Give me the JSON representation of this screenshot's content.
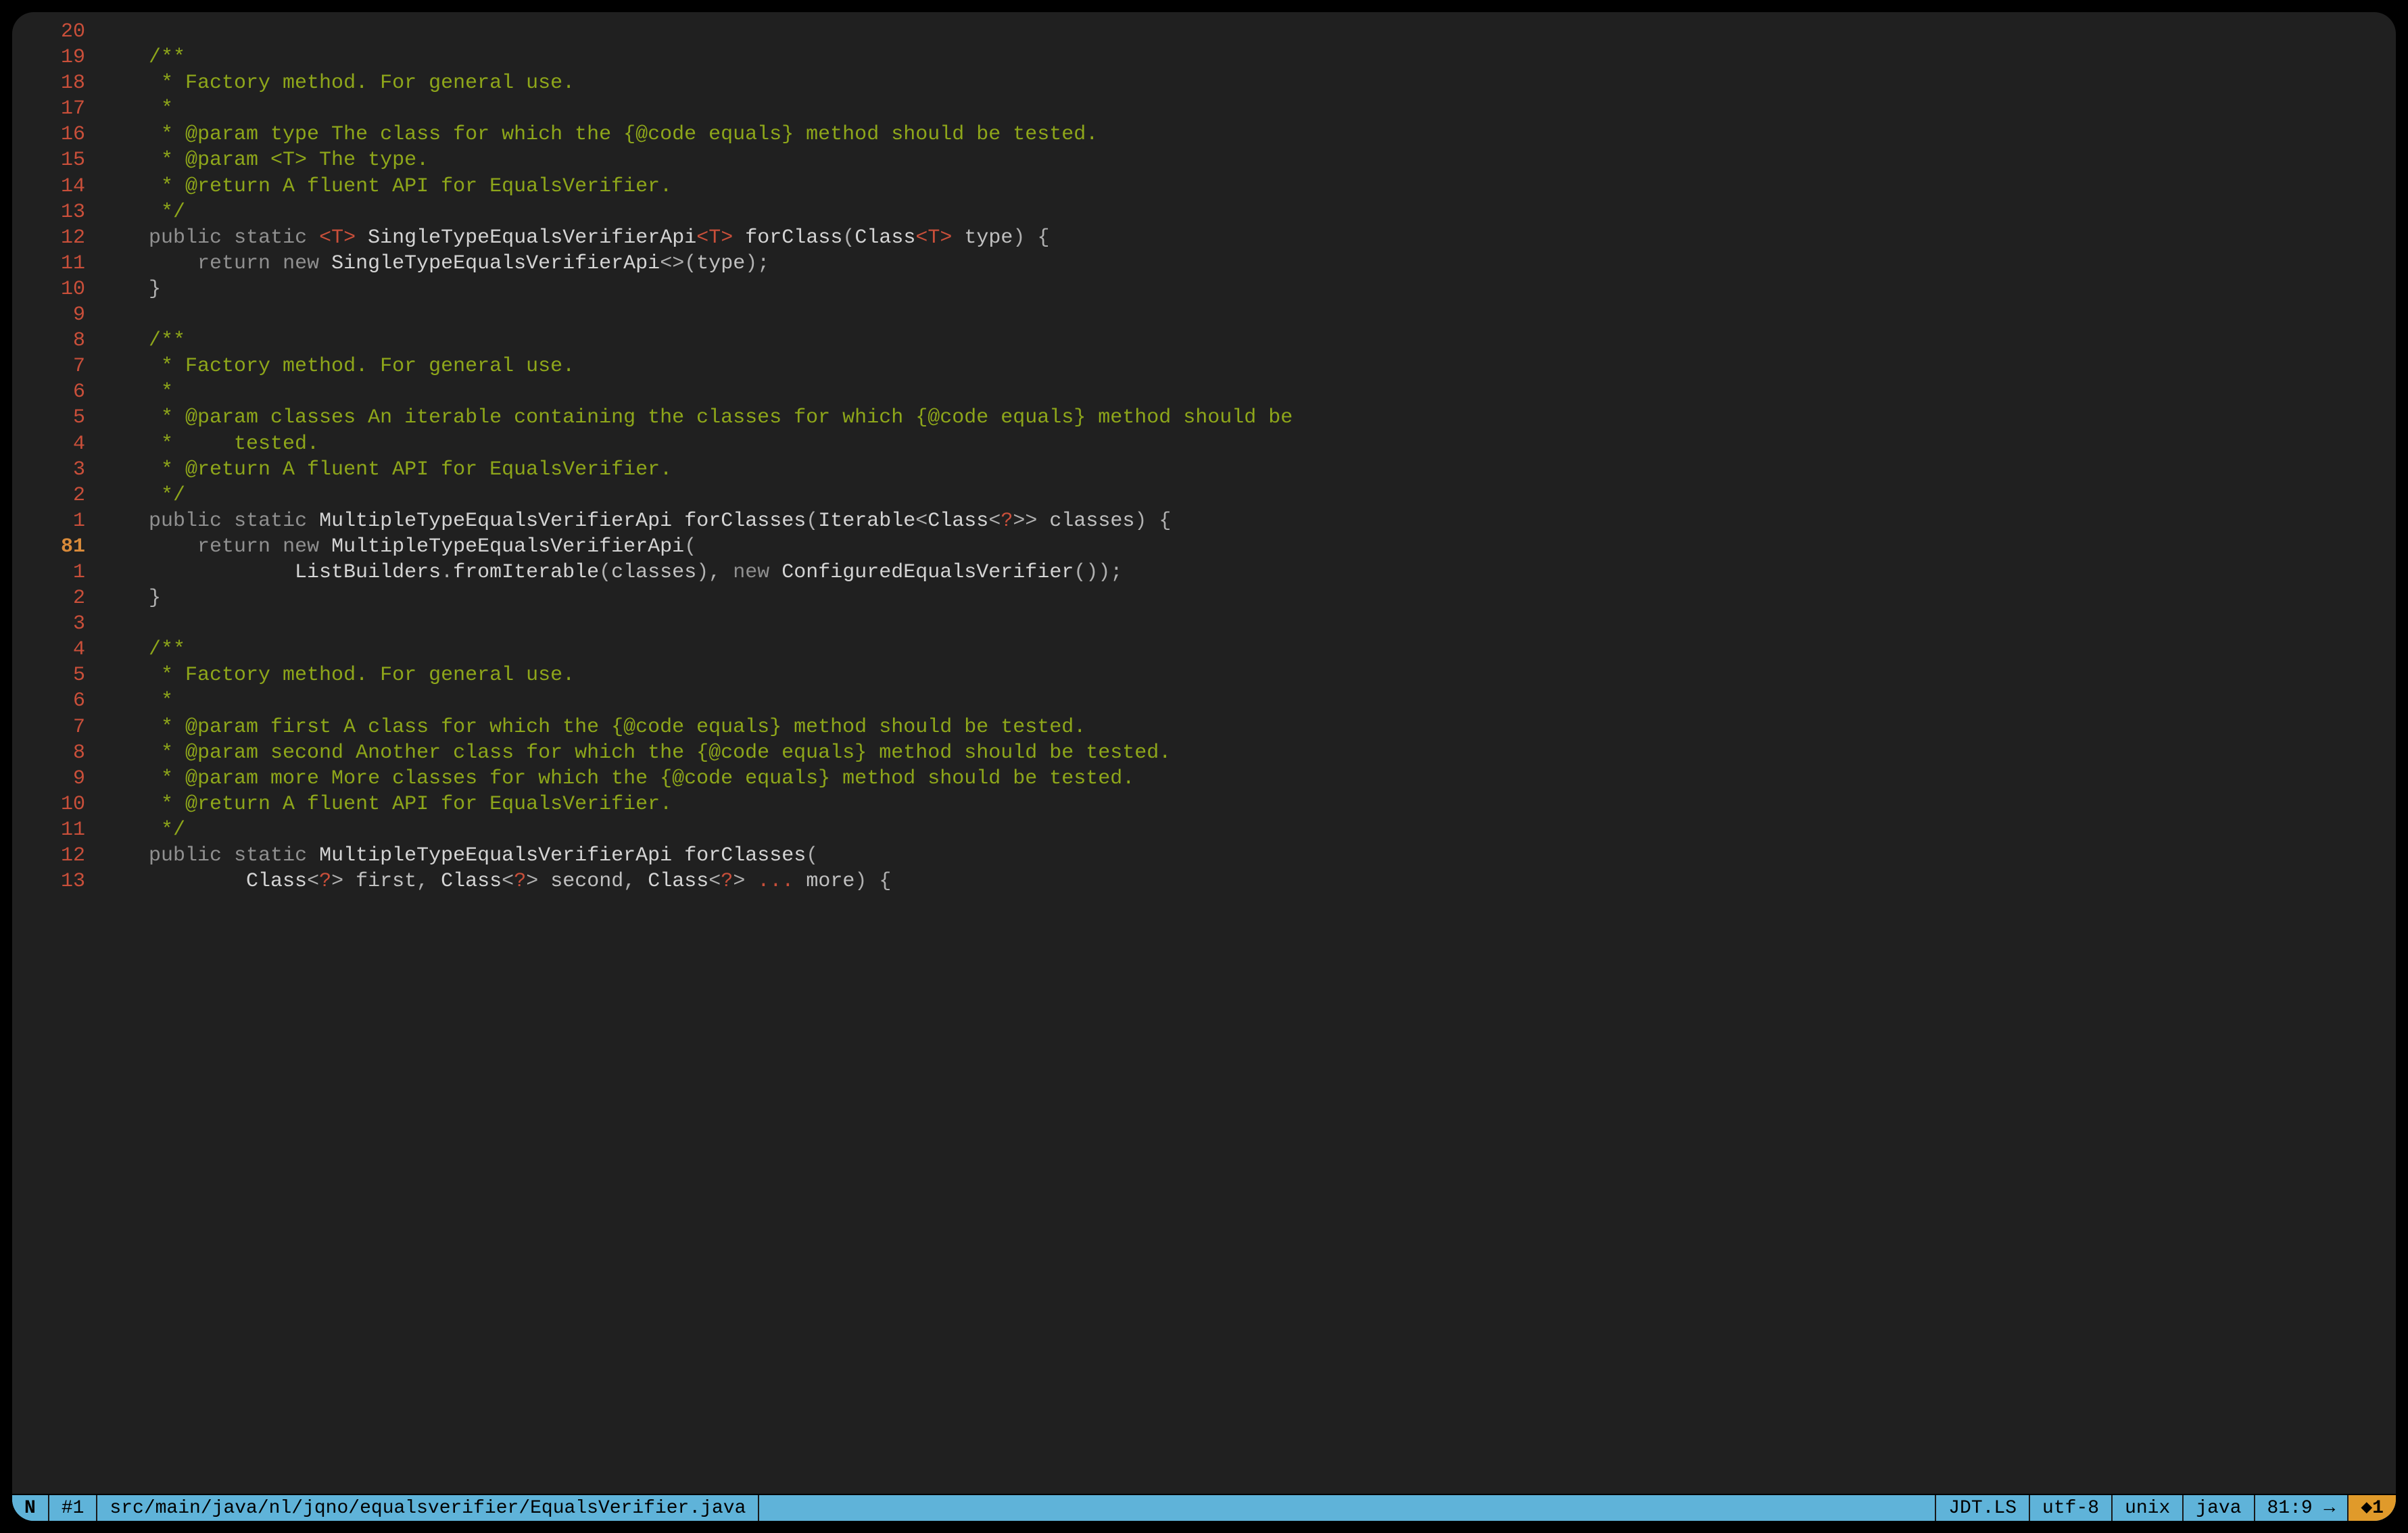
{
  "editor": {
    "relative_numbers": true,
    "current_absolute_line": 81,
    "gutter": [
      "20",
      "19",
      "18",
      "17",
      "16",
      "15",
      "14",
      "13",
      "12",
      "11",
      "10",
      "9",
      "8",
      "7",
      "6",
      "5",
      "4",
      "3",
      "2",
      "1",
      "81",
      "1",
      "2",
      "3",
      "4",
      "5",
      "6",
      "7",
      "8",
      "9",
      "10",
      "11",
      "12",
      "13"
    ],
    "lines": [
      {
        "t": "blank"
      },
      {
        "t": "comment",
        "text": "/**"
      },
      {
        "t": "comment",
        "text": " * Factory method. For general use."
      },
      {
        "t": "comment",
        "text": " *"
      },
      {
        "t": "comment",
        "text": " * @param type The class for which the {@code equals} method should be tested."
      },
      {
        "t": "comment",
        "text": " * @param <T> The type."
      },
      {
        "t": "comment",
        "text": " * @return A fluent API for EqualsVerifier."
      },
      {
        "t": "comment",
        "text": " */"
      },
      {
        "t": "sig1",
        "kw1": "public",
        "kw2": "static",
        "lt": "<",
        "tp": "T",
        "gt": ">",
        "ret": " SingleTypeEqualsVerifierApi",
        "lt2": "<",
        "tp2": "T",
        "gt2": ">",
        "m": " forClass",
        "p1": "(",
        "cls": "Class",
        "lt3": "<",
        "tp3": "T",
        "gt3": ">",
        "arg": " type",
        "p2": ")",
        "br": " {"
      },
      {
        "t": "ret1",
        "kw": "return",
        "kw2": "new",
        "cls": " SingleTypeEqualsVerifierApi",
        "di": "<>",
        "p1": "(",
        "arg": "type",
        "p2": ")",
        "sc": ";"
      },
      {
        "t": "close",
        "text": "}"
      },
      {
        "t": "blank"
      },
      {
        "t": "comment",
        "text": "/**"
      },
      {
        "t": "comment",
        "text": " * Factory method. For general use."
      },
      {
        "t": "comment",
        "text": " *"
      },
      {
        "t": "comment",
        "text": " * @param classes An iterable containing the classes for which {@code equals} method should be"
      },
      {
        "t": "comment",
        "text": " *     tested."
      },
      {
        "t": "comment",
        "text": " * @return A fluent API for EqualsVerifier."
      },
      {
        "t": "comment",
        "text": " */"
      },
      {
        "t": "sig2",
        "kw1": "public",
        "kw2": "static",
        "ret": " MultipleTypeEqualsVerifierApi",
        "m": " forClasses",
        "p1": "(",
        "it": "Iterable",
        "lt": "<",
        "cls": "Class",
        "lt2": "<",
        "q": "?",
        "gt2": ">>",
        "arg": " classes",
        "p2": ")",
        "br": " {"
      },
      {
        "t": "ret2",
        "kw": "return",
        "kw2": "new",
        "cls": " MultipleTypeEqualsVerifierApi",
        "p1": "("
      },
      {
        "t": "ret2b",
        "cls": "ListBuilders",
        "dot": ".",
        "m": "fromIterable",
        "p1": "(",
        "arg": "classes",
        "p2": ")",
        "c": ", ",
        "kw": "new",
        "cls2": " ConfiguredEqualsVerifier",
        "p3": "()",
        "p4": ")",
        "sc": ";"
      },
      {
        "t": "close",
        "text": "}"
      },
      {
        "t": "blank"
      },
      {
        "t": "comment",
        "text": "/**"
      },
      {
        "t": "comment",
        "text": " * Factory method. For general use."
      },
      {
        "t": "comment",
        "text": " *"
      },
      {
        "t": "comment",
        "text": " * @param first A class for which the {@code equals} method should be tested."
      },
      {
        "t": "comment",
        "text": " * @param second Another class for which the {@code equals} method should be tested."
      },
      {
        "t": "comment",
        "text": " * @param more More classes for which the {@code equals} method should be tested."
      },
      {
        "t": "comment",
        "text": " * @return A fluent API for EqualsVerifier."
      },
      {
        "t": "comment",
        "text": " */"
      },
      {
        "t": "sig3",
        "kw1": "public",
        "kw2": "static",
        "ret": " MultipleTypeEqualsVerifierApi",
        "m": " forClasses",
        "p1": "("
      },
      {
        "t": "sig3b",
        "cls": "Class",
        "lt": "<",
        "q": "?",
        "gt": ">",
        "a1": " first",
        "c1": ", ",
        "cls2": "Class",
        "lt2": "<",
        "q2": "?",
        "gt2": ">",
        "a2": " second",
        "c2": ", ",
        "cls3": "Class",
        "lt3": "<",
        "q3": "?",
        "gt3": ">",
        "dots": " ...",
        "a3": " more",
        "p2": ")",
        "br": " {"
      }
    ]
  },
  "statusbar": {
    "mode": "N",
    "buffer": "#1",
    "path": "src/main/java/nl/jqno/equalsverifier/EqualsVerifier.java",
    "lsp": "JDT.LS",
    "encoding": "utf-8",
    "fileformat": "unix",
    "filetype": "java",
    "position": "81:9 →",
    "warning": "◆1"
  }
}
